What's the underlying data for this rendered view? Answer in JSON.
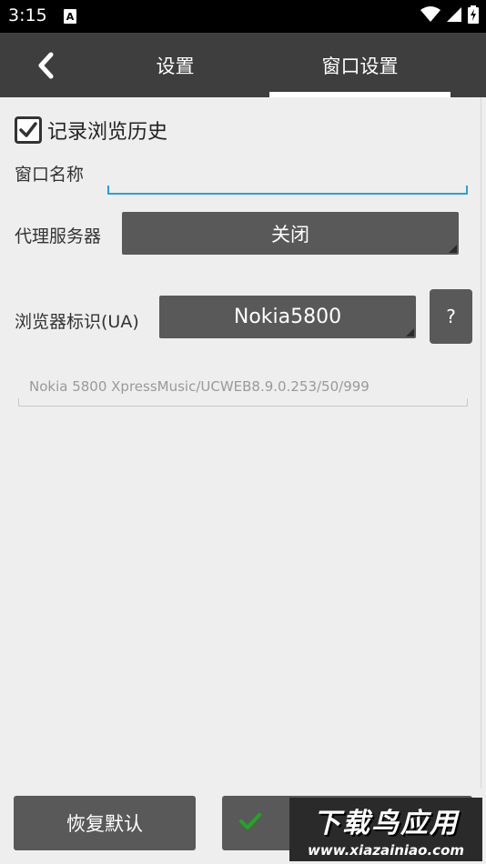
{
  "status_bar": {
    "time": "3:15",
    "notification_icon": "A"
  },
  "header": {
    "tabs": [
      {
        "label": "设置"
      },
      {
        "label": "窗口设置"
      }
    ],
    "active_tab": 1
  },
  "history": {
    "checked": true,
    "label": "记录浏览历史"
  },
  "window_name": {
    "label": "窗口名称",
    "value": ""
  },
  "proxy": {
    "label": "代理服务器",
    "value": "关闭"
  },
  "user_agent": {
    "label": "浏览器标识(UA)",
    "value": "Nokia5800",
    "help_label": "?",
    "ua_string": "Nokia 5800 XpressMusic/UCWEB8.9.0.253/50/999"
  },
  "footer": {
    "reset_label": "恢复默认"
  },
  "watermark": {
    "top": "下载鸟应用",
    "bottom": "www.xiazainiao.com"
  },
  "colors": {
    "header": "#3e3e3e",
    "button": "#595959",
    "accent": "#2f9ed6",
    "check": "#1fa81f"
  }
}
